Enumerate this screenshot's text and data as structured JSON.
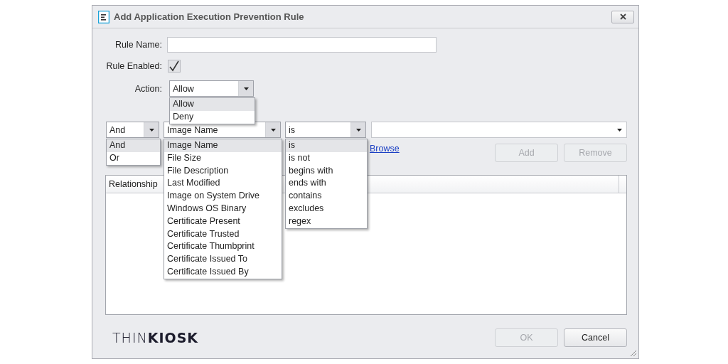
{
  "window": {
    "title": "Add Application Execution Prevention Rule"
  },
  "form": {
    "rule_name": {
      "label": "Rule Name:"
    },
    "rule_enabled": {
      "label": "Rule Enabled:",
      "checked": true
    },
    "action": {
      "label": "Action:",
      "value": "Allow",
      "expanded": true,
      "options": [
        {
          "label": "Allow",
          "selected": true
        },
        {
          "label": "Deny",
          "selected": false
        }
      ]
    }
  },
  "condition": {
    "relationship": {
      "value": "And",
      "expanded": true,
      "options": [
        {
          "label": "And",
          "selected": true
        },
        {
          "label": "Or",
          "selected": false
        }
      ]
    },
    "field": {
      "value": "Image Name",
      "expanded": true,
      "options": [
        {
          "label": "Image Name",
          "selected": true
        },
        {
          "label": "File Size",
          "selected": false
        },
        {
          "label": "File Description",
          "selected": false
        },
        {
          "label": "Last Modified",
          "selected": false
        },
        {
          "label": "Image on System Drive",
          "selected": false
        },
        {
          "label": "Windows OS Binary",
          "selected": false
        },
        {
          "label": "Certificate Present",
          "selected": false
        },
        {
          "label": "Certificate Trusted",
          "selected": false
        },
        {
          "label": "Certificate Thumbprint",
          "selected": false
        },
        {
          "label": "Certificate Issued To",
          "selected": false
        },
        {
          "label": "Certificate Issued By",
          "selected": false
        }
      ]
    },
    "operator": {
      "value": "is",
      "expanded": true,
      "options": [
        {
          "label": "is",
          "selected": true
        },
        {
          "label": "is not",
          "selected": false
        },
        {
          "label": "begins with",
          "selected": false
        },
        {
          "label": "ends with",
          "selected": false
        },
        {
          "label": "contains",
          "selected": false
        },
        {
          "label": "excludes",
          "selected": false
        },
        {
          "label": "regex",
          "selected": false
        }
      ]
    }
  },
  "browse_link": "Browse",
  "buttons": [
    {
      "label": "Add",
      "disabled": true
    },
    {
      "label": "Remove",
      "disabled": true
    }
  ],
  "table": {
    "columns": [
      "Relationship"
    ]
  },
  "logo": "THIN**KIOSK**",
  "footer_buttons": [
    {
      "label": "OK",
      "disabled": true
    },
    {
      "label": "Cancel",
      "disabled": false
    }
  ]
}
